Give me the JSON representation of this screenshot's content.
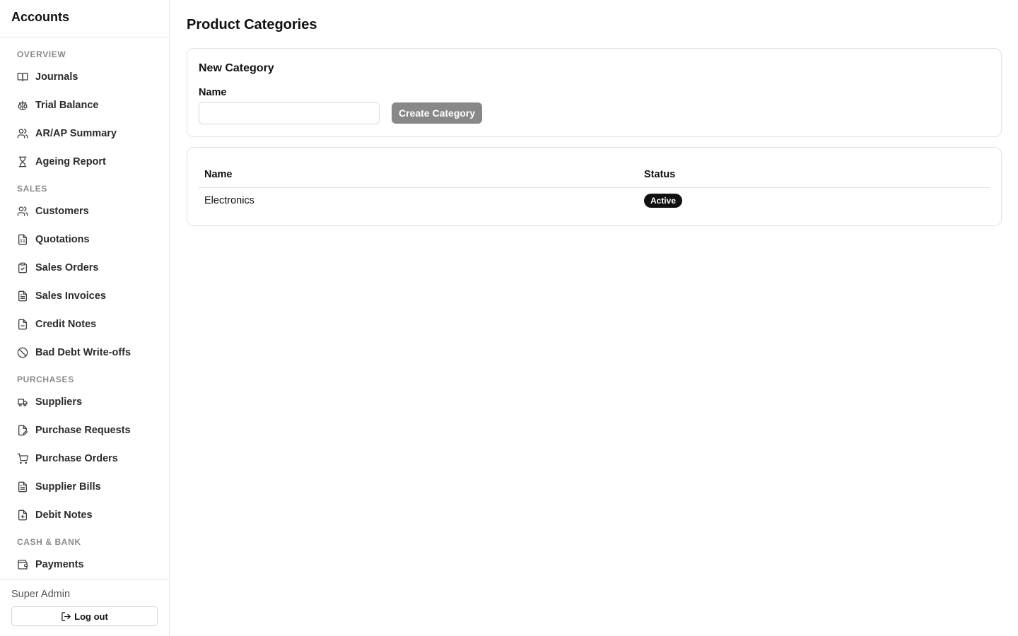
{
  "sidebar": {
    "brand": "Accounts",
    "sections": [
      {
        "label": "OVERVIEW",
        "items": [
          {
            "label": "Journals",
            "icon": "book-open-icon"
          },
          {
            "label": "Trial Balance",
            "icon": "scale-icon"
          },
          {
            "label": "AR/AP Summary",
            "icon": "users-icon"
          },
          {
            "label": "Ageing Report",
            "icon": "hourglass-icon"
          }
        ]
      },
      {
        "label": "SALES",
        "items": [
          {
            "label": "Customers",
            "icon": "users-icon"
          },
          {
            "label": "Quotations",
            "icon": "file-spreadsheet-icon"
          },
          {
            "label": "Sales Orders",
            "icon": "clipboard-check-icon"
          },
          {
            "label": "Sales Invoices",
            "icon": "file-text-icon"
          },
          {
            "label": "Credit Notes",
            "icon": "file-minus-icon"
          },
          {
            "label": "Bad Debt Write-offs",
            "icon": "ban-icon"
          }
        ]
      },
      {
        "label": "PURCHASES",
        "items": [
          {
            "label": "Suppliers",
            "icon": "truck-icon"
          },
          {
            "label": "Purchase Requests",
            "icon": "file-pen-icon"
          },
          {
            "label": "Purchase Orders",
            "icon": "shopping-cart-icon"
          },
          {
            "label": "Supplier Bills",
            "icon": "file-text-icon"
          },
          {
            "label": "Debit Notes",
            "icon": "file-plus-icon"
          }
        ]
      },
      {
        "label": "CASH & BANK",
        "items": [
          {
            "label": "Payments",
            "icon": "wallet-icon"
          }
        ]
      }
    ],
    "user": "Super Admin",
    "logout_label": "Log out"
  },
  "main": {
    "title": "Product Categories",
    "new_category": {
      "title": "New Category",
      "name_label": "Name",
      "name_value": "",
      "submit_label": "Create Category"
    },
    "table": {
      "columns": [
        "Name",
        "Status"
      ],
      "rows": [
        {
          "name": "Electronics",
          "status": "Active"
        }
      ]
    }
  },
  "colors": {
    "accent_button": "#888888",
    "badge_bg": "#111111",
    "section_label": "#8a8a8a",
    "border": "#e3e3e3"
  }
}
